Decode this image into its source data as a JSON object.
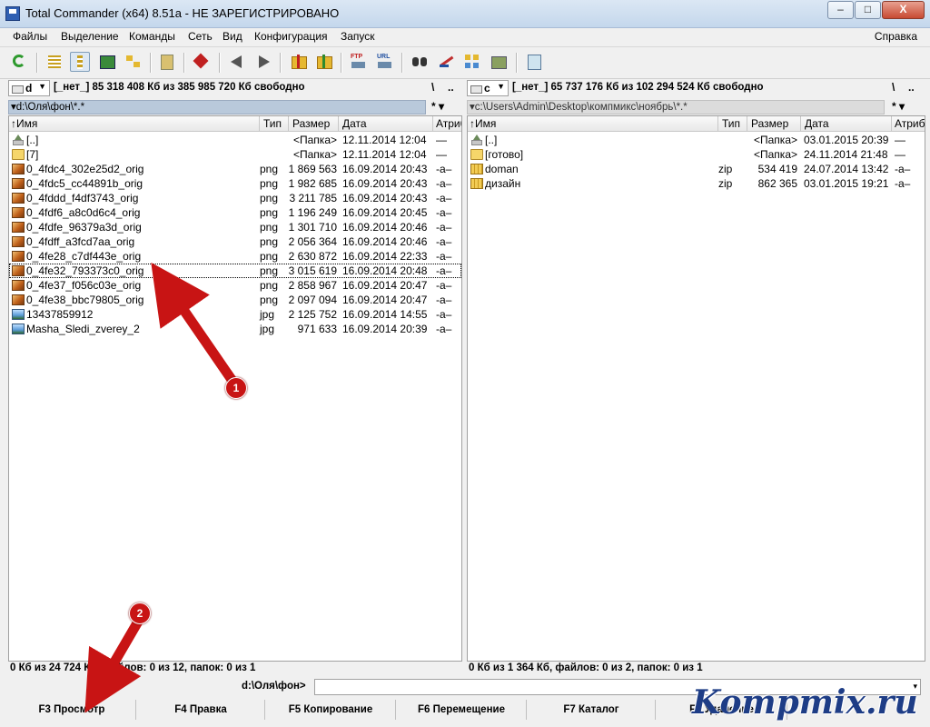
{
  "window": {
    "title": "Total Commander (x64) 8.51a - НЕ ЗАРЕГИСТРИРОВАНО",
    "buttons": {
      "minimize": "–",
      "maximize": "□",
      "close": "X"
    }
  },
  "menu": {
    "items": [
      "Файлы",
      "Выделение",
      "Команды",
      "Сеть",
      "Вид",
      "Конфигурация",
      "Запуск"
    ],
    "help": "Справка"
  },
  "toolbar": {
    "icons": [
      "refresh-icon",
      "brief-view-icon",
      "full-view-icon",
      "thumbnails-icon",
      "tree-view-icon",
      "invert-selection-icon",
      "select-files-icon",
      "back-icon",
      "forward-icon",
      "pack-icon",
      "unpack-icon",
      "ftp-icon",
      "url-ftp-icon",
      "find-icon",
      "rename-icon",
      "sync-icon",
      "compare-icon",
      "notepad-icon"
    ]
  },
  "left_panel": {
    "drive": "d",
    "drive_info": "[_нет_]  85 318 408 Кб из 385 985 720 Кб свободно",
    "root_label": "\\",
    "up_label": "..",
    "path": "▾d:\\Оля\\фон\\*.*",
    "history": "*  ▾",
    "columns": {
      "name": "↑Имя",
      "type": "Тип",
      "size": "Размер",
      "date": "Дата",
      "attr": "Атриб"
    },
    "files": [
      {
        "icon": "up",
        "name": "[..]",
        "type": "",
        "size": "<Папка>",
        "date": "12.11.2014 12:04",
        "attr": "—"
      },
      {
        "icon": "folder",
        "name": "[7]",
        "type": "",
        "size": "<Папка>",
        "date": "12.11.2014 12:04",
        "attr": "—"
      },
      {
        "icon": "png",
        "name": "0_4fdc4_302e25d2_orig",
        "type": "png",
        "size": "1 869 563",
        "date": "16.09.2014 20:43",
        "attr": "-a–"
      },
      {
        "icon": "png",
        "name": "0_4fdc5_cc44891b_orig",
        "type": "png",
        "size": "1 982 685",
        "date": "16.09.2014 20:43",
        "attr": "-a–"
      },
      {
        "icon": "png",
        "name": "0_4fddd_f4df3743_orig",
        "type": "png",
        "size": "3 211 785",
        "date": "16.09.2014 20:43",
        "attr": "-a–"
      },
      {
        "icon": "png",
        "name": "0_4fdf6_a8c0d6c4_orig",
        "type": "png",
        "size": "1 196 249",
        "date": "16.09.2014 20:45",
        "attr": "-a–"
      },
      {
        "icon": "png",
        "name": "0_4fdfe_96379a3d_orig",
        "type": "png",
        "size": "1 301 710",
        "date": "16.09.2014 20:46",
        "attr": "-a–"
      },
      {
        "icon": "png",
        "name": "0_4fdff_a3fcd7aa_orig",
        "type": "png",
        "size": "2 056 364",
        "date": "16.09.2014 20:46",
        "attr": "-a–"
      },
      {
        "icon": "png",
        "name": "0_4fe28_c7df443e_orig",
        "type": "png",
        "size": "2 630 872",
        "date": "16.09.2014 22:33",
        "attr": "-a–"
      },
      {
        "icon": "png",
        "name": "0_4fe32_793373c0_orig",
        "type": "png",
        "size": "3 015 619",
        "date": "16.09.2014 20:48",
        "attr": "-a–",
        "cursor": true
      },
      {
        "icon": "png",
        "name": "0_4fe37_f056c03e_orig",
        "type": "png",
        "size": "2 858 967",
        "date": "16.09.2014 20:47",
        "attr": "-a–"
      },
      {
        "icon": "png",
        "name": "0_4fe38_bbc79805_orig",
        "type": "png",
        "size": "2 097 094",
        "date": "16.09.2014 20:47",
        "attr": "-a–"
      },
      {
        "icon": "jpg",
        "name": "13437859912",
        "type": "jpg",
        "size": "2 125 752",
        "date": "16.09.2014 14:55",
        "attr": "-a–"
      },
      {
        "icon": "jpg",
        "name": "Masha_Sledi_zverey_2",
        "type": "jpg",
        "size": "971 633",
        "date": "16.09.2014 20:39",
        "attr": "-a–"
      }
    ],
    "status": "0 Кб из 24 724 Кб, файлов: 0 из 12, папок: 0 из 1"
  },
  "right_panel": {
    "drive": "c",
    "drive_info": "[_нет_]  65 737 176 Кб из 102 294 524 Кб свободно",
    "root_label": "\\",
    "up_label": "..",
    "path": "▾c:\\Users\\Admin\\Desktop\\компмикс\\ноябрь\\*.*",
    "history": "*  ▾",
    "columns": {
      "name": "↑Имя",
      "type": "Тип",
      "size": "Размер",
      "date": "Дата",
      "attr": "Атриб"
    },
    "files": [
      {
        "icon": "up",
        "name": "[..]",
        "type": "",
        "size": "<Папка>",
        "date": "03.01.2015 20:39",
        "attr": "—"
      },
      {
        "icon": "folder",
        "name": "[готово]",
        "type": "",
        "size": "<Папка>",
        "date": "24.11.2014 21:48",
        "attr": "—"
      },
      {
        "icon": "zip",
        "name": "doman",
        "type": "zip",
        "size": "534 419",
        "date": "24.07.2014 13:42",
        "attr": "-a–"
      },
      {
        "icon": "zip",
        "name": "дизайн",
        "type": "zip",
        "size": "862 365",
        "date": "03.01.2015 19:21",
        "attr": "-a–"
      }
    ],
    "status": "0 Кб из 1 364 Кб, файлов: 0 из 2, папок: 0 из 1"
  },
  "command_line": {
    "label": "d:\\Оля\\фон>",
    "value": "",
    "arrow": "▾"
  },
  "function_keys": [
    "F3 Просмотр",
    "F4 Правка",
    "F5 Копирование",
    "F6 Перемещение",
    "F7 Каталог",
    "F8 Удаление"
  ],
  "annotations": {
    "badge1": "1",
    "badge2": "2",
    "watermark": "Kompmix.ru",
    "arrow_color": "#c81414"
  }
}
